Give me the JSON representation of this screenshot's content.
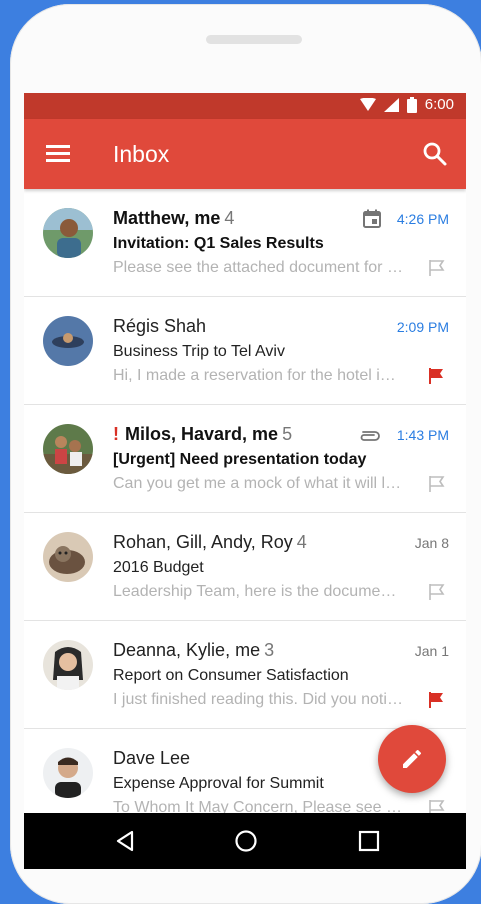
{
  "status": {
    "time": "6:00"
  },
  "appbar": {
    "title": "Inbox"
  },
  "emails": [
    {
      "sender": "Matthew, me",
      "count": "4",
      "time": "4:26 PM",
      "subject": "Invitation: Q1 Sales Results",
      "snippet": "Please see the attached document for the details",
      "flagged": false,
      "important": false,
      "icon": "calendar-icon"
    },
    {
      "sender": "Régis Shah",
      "count": "",
      "time": "2:09 PM",
      "subject": "Business Trip to Tel Aviv",
      "snippet": "Hi, I made a reservation for the hotel in advance",
      "flagged": true,
      "important": false,
      "icon": ""
    },
    {
      "sender": "Milos, Havard, me",
      "count": "5",
      "time": "1:43 PM",
      "subject": "[Urgent] Need presentation today",
      "snippet": "Can you get me a mock of what it will look like",
      "flagged": false,
      "important": true,
      "icon": "attachment-icon",
      "important_mark": "!"
    },
    {
      "sender": "Rohan, Gill, Andy, Roy",
      "count": "4",
      "time": "Jan 8",
      "subject": "2016 Budget",
      "snippet": "Leadership Team, here is the document for review",
      "flagged": false,
      "important": false,
      "icon": ""
    },
    {
      "sender": "Deanna, Kylie, me",
      "count": "3",
      "time": "Jan 1",
      "subject": "Report on Consumer Satisfaction",
      "snippet": "I just finished reading this. Did you notice the trend",
      "flagged": true,
      "important": false,
      "icon": ""
    },
    {
      "sender": "Dave Lee",
      "count": "",
      "time": "",
      "subject": "Expense Approval for Summit",
      "snippet": "To Whom It May Concern, Please see the attached",
      "flagged": false,
      "important": false,
      "icon": ""
    }
  ],
  "colors": {
    "accent": "#e0493b",
    "status": "#c0392b",
    "flag_active": "#d93025",
    "time_blue": "#2a7de1"
  }
}
